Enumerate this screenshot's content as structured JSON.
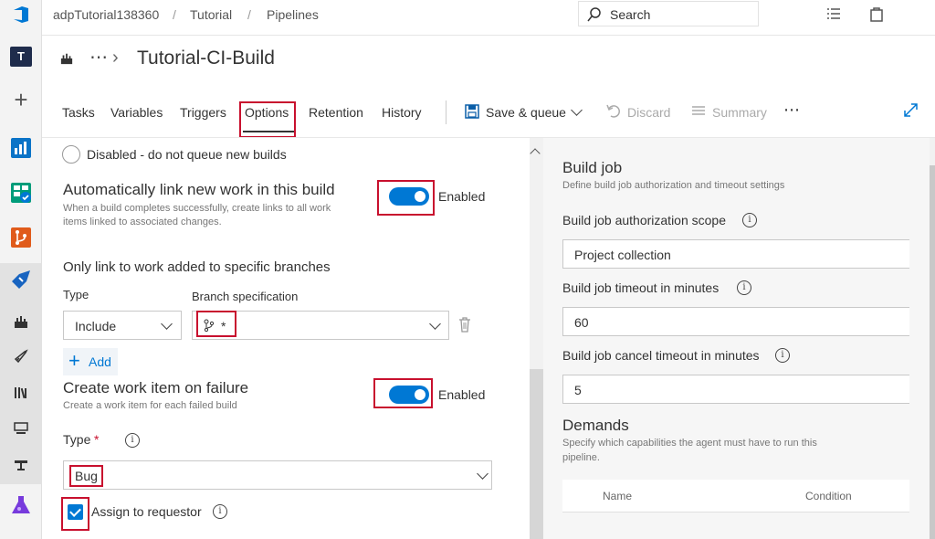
{
  "breadcrumb": {
    "org": "adpTutorial138360",
    "project": "Tutorial",
    "section": "Pipelines",
    "separator": "/"
  },
  "search": {
    "label": "Search"
  },
  "rail": {
    "avatar_letter": "T"
  },
  "header": {
    "more": "⋯",
    "title": "Tutorial-CI-Build"
  },
  "tabs": [
    "Tasks",
    "Variables",
    "Triggers",
    "Options",
    "Retention",
    "History"
  ],
  "active_tab": "Options",
  "toolbar": {
    "save_queue": "Save & queue",
    "discard": "Discard",
    "summary": "Summary",
    "more": "⋯"
  },
  "options": {
    "disabled_label": "Disabled - do not queue new builds",
    "auto_link": {
      "title": "Automatically link new work in this build",
      "description_line1": "When a build completes successfully, create links to all work",
      "description_line2": "items linked to associated changes.",
      "toggle_label": "Enabled",
      "enabled": true
    },
    "branch_filter": {
      "title": "Only link to work added to specific branches",
      "type_label": "Type",
      "spec_label": "Branch specification",
      "type_value": "Include",
      "spec_value": "*",
      "add_label": "Add"
    },
    "work_item_on_failure": {
      "title": "Create work item on failure",
      "description": "Create a work item for each failed build",
      "toggle_label": "Enabled",
      "enabled": true,
      "type_label": "Type",
      "required_mark": "*",
      "type_value": "Bug",
      "assign_label": "Assign to requestor",
      "assign_checked": true
    }
  },
  "build_job": {
    "title": "Build job",
    "description": "Define build job authorization and timeout settings",
    "auth_scope_label": "Build job authorization scope",
    "auth_scope_value": "Project collection",
    "timeout_label": "Build job timeout in minutes",
    "timeout_value": "60",
    "cancel_timeout_label": "Build job cancel timeout in minutes",
    "cancel_timeout_value": "5"
  },
  "demands": {
    "title": "Demands",
    "description_line1": "Specify which capabilities the agent must have to run this",
    "description_line2": "pipeline.",
    "columns": [
      "Name",
      "Condition"
    ]
  },
  "colors": {
    "accent": "#0078d4",
    "highlight_box": "#c8102e"
  }
}
